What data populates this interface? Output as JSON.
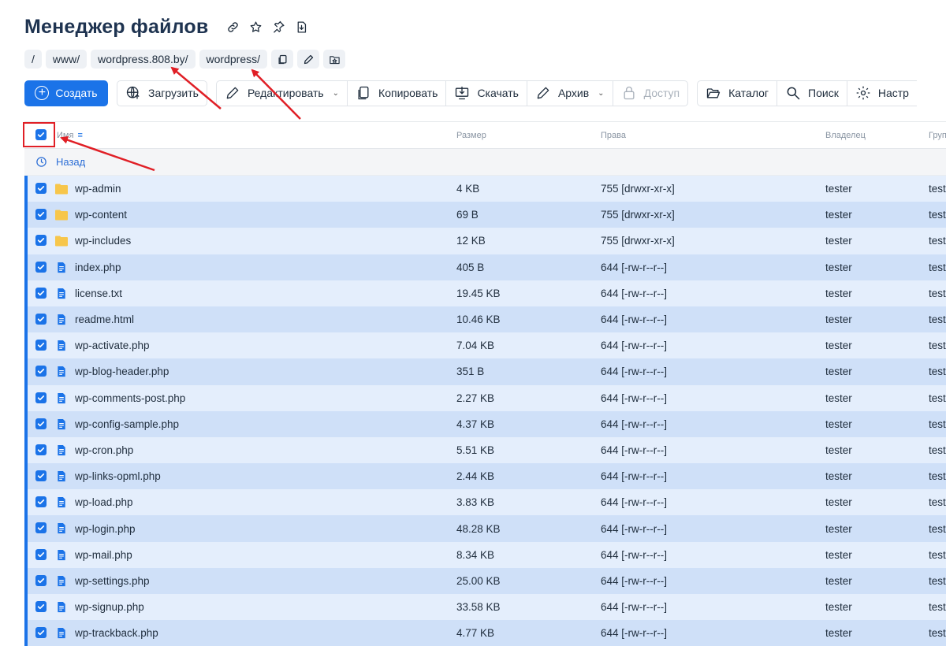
{
  "header": {
    "title": "Менеджер файлов"
  },
  "breadcrumbs": [
    "/",
    "www/",
    "wordpress.808.by/",
    "wordpress/"
  ],
  "toolbar": {
    "create": "Создать",
    "upload": "Загрузить",
    "edit": "Редактировать",
    "copy": "Копировать",
    "download": "Скачать",
    "archive": "Архив",
    "access": "Доступ",
    "catalog": "Каталог",
    "search": "Поиск",
    "settings": "Настр"
  },
  "columns": {
    "name": "Имя",
    "size": "Размер",
    "perms": "Права",
    "owner": "Владелец",
    "group": "Груп"
  },
  "back_label": "Назад",
  "files": [
    {
      "name": "wp-admin",
      "type": "folder",
      "size": "4 KB",
      "perms": "755 [drwxr-xr-x]",
      "owner": "tester",
      "group": "test"
    },
    {
      "name": "wp-content",
      "type": "folder",
      "size": "69 B",
      "perms": "755 [drwxr-xr-x]",
      "owner": "tester",
      "group": "test"
    },
    {
      "name": "wp-includes",
      "type": "folder",
      "size": "12 KB",
      "perms": "755 [drwxr-xr-x]",
      "owner": "tester",
      "group": "test"
    },
    {
      "name": "index.php",
      "type": "file",
      "size": "405 B",
      "perms": "644 [-rw-r--r--]",
      "owner": "tester",
      "group": "test"
    },
    {
      "name": "license.txt",
      "type": "file",
      "size": "19.45 KB",
      "perms": "644 [-rw-r--r--]",
      "owner": "tester",
      "group": "test"
    },
    {
      "name": "readme.html",
      "type": "file",
      "size": "10.46 KB",
      "perms": "644 [-rw-r--r--]",
      "owner": "tester",
      "group": "test"
    },
    {
      "name": "wp-activate.php",
      "type": "file",
      "size": "7.04 KB",
      "perms": "644 [-rw-r--r--]",
      "owner": "tester",
      "group": "test"
    },
    {
      "name": "wp-blog-header.php",
      "type": "file",
      "size": "351 B",
      "perms": "644 [-rw-r--r--]",
      "owner": "tester",
      "group": "test"
    },
    {
      "name": "wp-comments-post.php",
      "type": "file",
      "size": "2.27 KB",
      "perms": "644 [-rw-r--r--]",
      "owner": "tester",
      "group": "test"
    },
    {
      "name": "wp-config-sample.php",
      "type": "file",
      "size": "4.37 KB",
      "perms": "644 [-rw-r--r--]",
      "owner": "tester",
      "group": "test"
    },
    {
      "name": "wp-cron.php",
      "type": "file",
      "size": "5.51 KB",
      "perms": "644 [-rw-r--r--]",
      "owner": "tester",
      "group": "test"
    },
    {
      "name": "wp-links-opml.php",
      "type": "file",
      "size": "2.44 KB",
      "perms": "644 [-rw-r--r--]",
      "owner": "tester",
      "group": "test"
    },
    {
      "name": "wp-load.php",
      "type": "file",
      "size": "3.83 KB",
      "perms": "644 [-rw-r--r--]",
      "owner": "tester",
      "group": "test"
    },
    {
      "name": "wp-login.php",
      "type": "file",
      "size": "48.28 KB",
      "perms": "644 [-rw-r--r--]",
      "owner": "tester",
      "group": "test"
    },
    {
      "name": "wp-mail.php",
      "type": "file",
      "size": "8.34 KB",
      "perms": "644 [-rw-r--r--]",
      "owner": "tester",
      "group": "test"
    },
    {
      "name": "wp-settings.php",
      "type": "file",
      "size": "25.00 KB",
      "perms": "644 [-rw-r--r--]",
      "owner": "tester",
      "group": "test"
    },
    {
      "name": "wp-signup.php",
      "type": "file",
      "size": "33.58 KB",
      "perms": "644 [-rw-r--r--]",
      "owner": "tester",
      "group": "test"
    },
    {
      "name": "wp-trackback.php",
      "type": "file",
      "size": "4.77 KB",
      "perms": "644 [-rw-r--r--]",
      "owner": "tester",
      "group": "test"
    }
  ],
  "colors": {
    "accent": "#1b73e8",
    "row_light": "#e4eefc",
    "row_dark": "#cfe0f8",
    "annotation": "#e01f26",
    "folder": "#f7c64b"
  }
}
